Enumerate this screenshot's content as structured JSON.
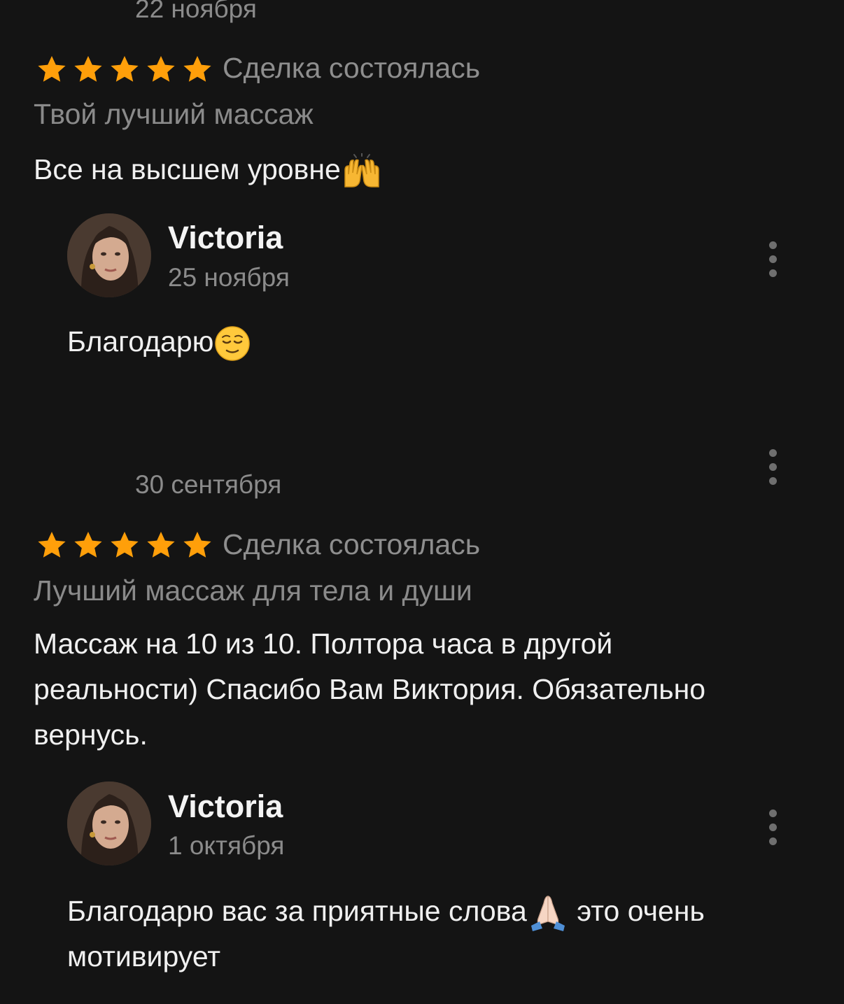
{
  "reviews": [
    {
      "date": "22 ноября",
      "rating": 5,
      "status": "Сделка состоялась",
      "title": "Твой лучший массаж",
      "text": "Все на высшем уровне",
      "text_emoji": "raising-hands-emoji",
      "reply": {
        "name": "Victoria",
        "date": "25 ноября",
        "text": "Благодарю",
        "text_emoji": "relieved-face-emoji"
      }
    },
    {
      "date": "30 сентября",
      "rating": 5,
      "status": "Сделка состоялась",
      "title": "Лучший массаж для тела и души",
      "text_line1": "Массаж на 10 из 10. Полтора часа в другой",
      "text_line2": "реальности) Спасибо Вам Виктория. Обязательно",
      "text_line3": "вернусь.",
      "reply": {
        "name": "Victoria",
        "date": "1 октября",
        "text_part1": "Благодарю вас за приятные слова",
        "text_emoji": "folded-hands-emoji",
        "text_part2": " это очень",
        "text_line2": "мотивирует"
      }
    }
  ],
  "colors": {
    "background": "#141414",
    "star": "#ff9f0a",
    "text_primary": "#f0f0f0",
    "text_secondary": "#8b8b8b"
  },
  "icons": [
    "star-icon",
    "more-vertical-icon",
    "avatar"
  ]
}
